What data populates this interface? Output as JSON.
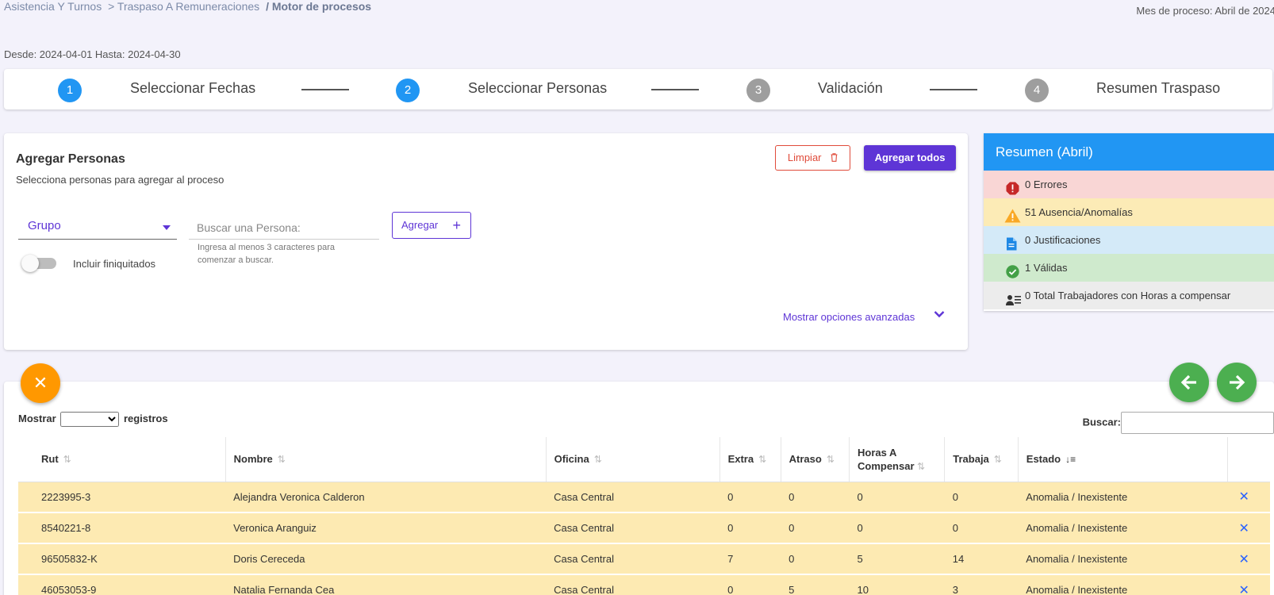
{
  "breadcrumb": {
    "items": [
      "Asistencia Y Turnos",
      "> Traspaso A Remuneraciones",
      "/ Motor de procesos"
    ]
  },
  "process_month": "Mes de proceso: Abril de 2024",
  "date_range": "Desde: 2024-04-01 Hasta: 2024-04-30",
  "stepper": {
    "steps": [
      {
        "num": "1",
        "label": "Seleccionar Fechas"
      },
      {
        "num": "2",
        "label": "Seleccionar Personas"
      },
      {
        "num": "3",
        "label": "Validación"
      },
      {
        "num": "4",
        "label": "Resumen Traspaso"
      }
    ]
  },
  "add_card": {
    "title": "Agregar Personas",
    "subtitle": "Selecciona personas para agregar al proceso",
    "clear_label": "Limpiar",
    "add_all_label": "Agregar todos",
    "group_label": "Grupo",
    "search_placeholder": "Buscar una Persona:",
    "search_hint": "Ingresa al menos 3 caracteres para comenzar a buscar.",
    "add_label": "Agregar",
    "toggle_label": "Incluir finiquitados",
    "advanced_label": "Mostrar opciones avanzadas"
  },
  "summary": {
    "title": "Resumen (Abril)",
    "rows": {
      "errors": "0 Errores",
      "anomalies": "51 Ausencia/Anomalías",
      "justifications": "0 Justificaciones",
      "valid": "1 Válidas",
      "total": "0 Total Trabajadores con Horas a compensar"
    }
  },
  "table": {
    "show_label": "Mostrar",
    "records_label": "registros",
    "search_label": "Buscar:",
    "columns": [
      "Rut",
      "Nombre",
      "Oficina",
      "Extra",
      "Atraso",
      "Horas A Compensar",
      "Trabaja",
      "Estado"
    ],
    "rows": [
      [
        "2223995-3",
        "Alejandra Veronica Calderon",
        "Casa Central",
        "0",
        "0",
        "0",
        "0",
        "Anomalia / Inexistente"
      ],
      [
        "8540221-8",
        "Veronica Aranguiz",
        "Casa Central",
        "0",
        "0",
        "0",
        "0",
        "Anomalia / Inexistente"
      ],
      [
        "96505832-K",
        "Doris Cereceda",
        "Casa Central",
        "7",
        "0",
        "5",
        "14",
        "Anomalia / Inexistente"
      ],
      [
        "46053053-9",
        "Natalia Fernanda Cea",
        "Casa Central",
        "0",
        "5",
        "10",
        "3",
        "Anomalia / Inexistente"
      ]
    ]
  },
  "colors": {
    "accent": "#5e35d6",
    "primary": "#2196f3",
    "warning_row": "#fdeab2",
    "success": "#4caf50",
    "orange": "#ff9800"
  }
}
